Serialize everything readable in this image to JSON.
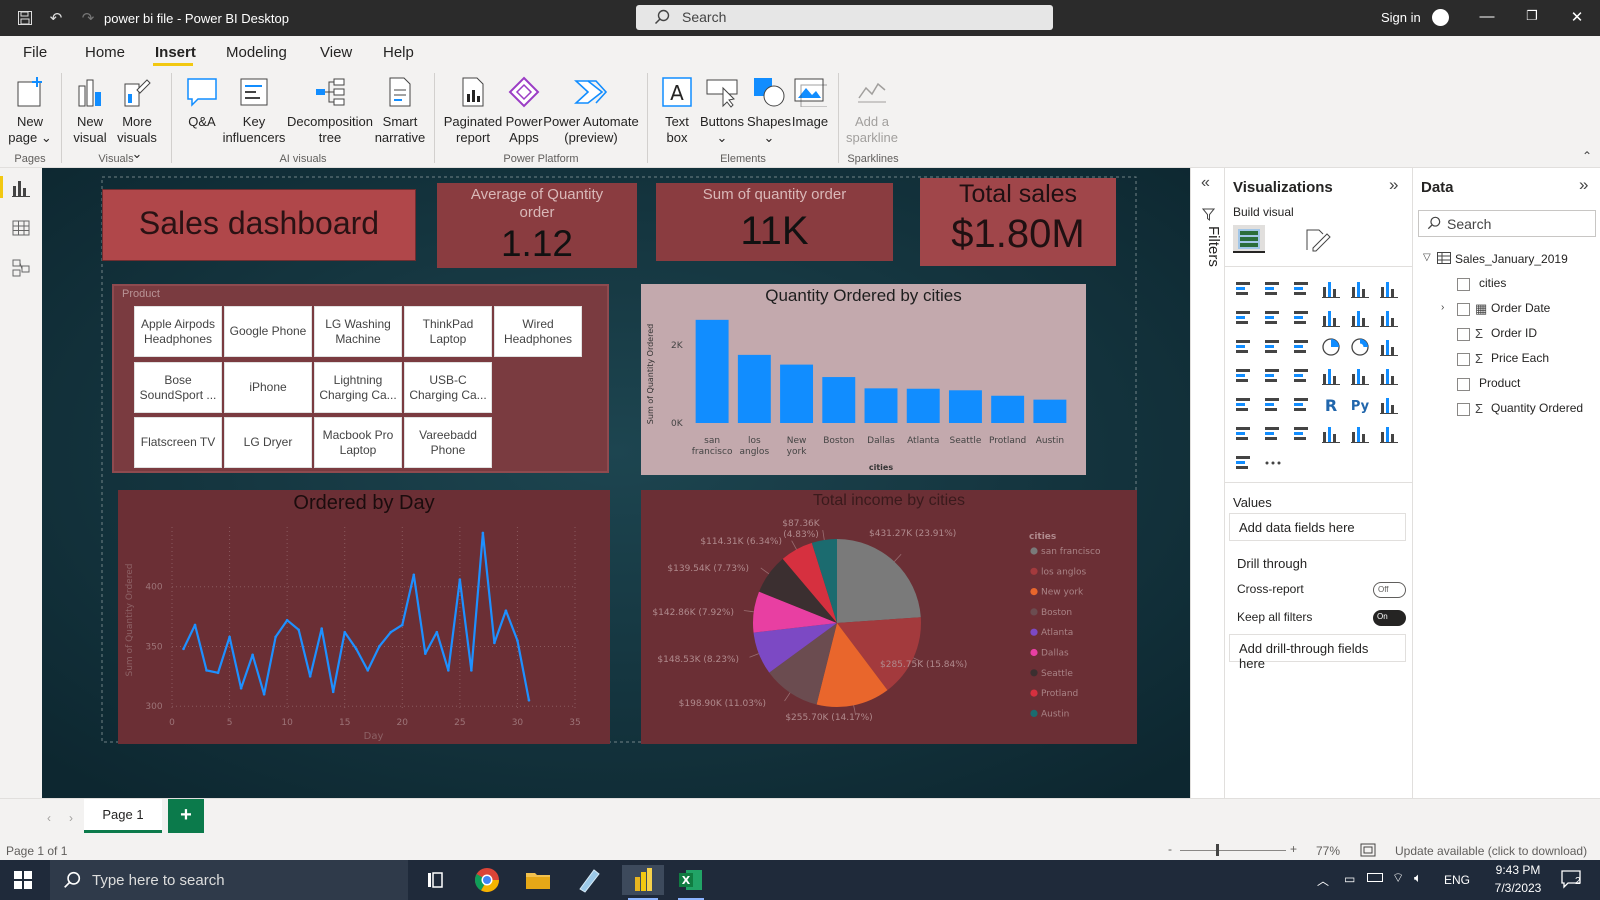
{
  "titlebar": {
    "title": "power bi file - Power BI Desktop",
    "search_placeholder": "Search",
    "signin": "Sign in"
  },
  "menu": [
    "File",
    "Home",
    "Insert",
    "Modeling",
    "View",
    "Help"
  ],
  "ribbon": {
    "buttons": [
      {
        "label1": "New",
        "label2": "page ⌄"
      },
      {
        "label1": "New",
        "label2": "visual"
      },
      {
        "label1": "More",
        "label2": "visuals ⌄"
      },
      {
        "label1": "Q&A",
        "label2": ""
      },
      {
        "label1": "Key",
        "label2": "influencers"
      },
      {
        "label1": "Decomposition",
        "label2": "tree"
      },
      {
        "label1": "Smart",
        "label2": "narrative"
      },
      {
        "label1": "Paginated",
        "label2": "report"
      },
      {
        "label1": "Power",
        "label2": "Apps"
      },
      {
        "label1": "Power Automate",
        "label2": "(preview)"
      },
      {
        "label1": "Text",
        "label2": "box"
      },
      {
        "label1": "Buttons",
        "label2": "⌄"
      },
      {
        "label1": "Shapes",
        "label2": "⌄"
      },
      {
        "label1": "Image",
        "label2": ""
      },
      {
        "label1": "Add a",
        "label2": "sparkline"
      }
    ],
    "groups": [
      "Pages",
      "Visuals",
      "AI visuals",
      "Power Platform",
      "Elements",
      "Sparklines"
    ]
  },
  "dashboard": {
    "title": "Sales dashboard",
    "cards": [
      {
        "label": "Average of Quantity order",
        "value": "1.12"
      },
      {
        "label": "Sum of quantity order",
        "value": "11K"
      },
      {
        "label": "Total sales",
        "value": "$1.80M"
      }
    ],
    "slicer": {
      "title": "Product",
      "items": [
        "Apple Airpods Headphones",
        "Google Phone",
        "LG Washing Machine",
        "ThinkPad Laptop",
        "Wired Headphones",
        "Bose SoundSport ...",
        "iPhone",
        "Lightning Charging Ca...",
        "USB-C Charging Ca...",
        "Flatscreen TV",
        "LG Dryer",
        "Macbook Pro Laptop",
        "Vareebadd Phone"
      ]
    }
  },
  "chart_data": [
    {
      "type": "bar",
      "title": "Quantity Ordered by cities",
      "xlabel": "cities",
      "ylabel": "Sum of Quantity Ordered",
      "categories": [
        "san francisco",
        "los anglos",
        "New york",
        "Boston",
        "Dallas",
        "Atlanta",
        "Seattle",
        "Protland",
        "Austin"
      ],
      "values": [
        2650,
        1750,
        1500,
        1180,
        890,
        880,
        840,
        700,
        600
      ],
      "ylim": [
        0,
        2800
      ],
      "yticks": [
        0,
        2000
      ],
      "ytick_labels": [
        "0K",
        "2K"
      ],
      "color": "#118dff"
    },
    {
      "type": "line",
      "title": "Ordered by Day",
      "xlabel": "Day",
      "ylabel": "Sum of Quantity Ordered",
      "x": [
        1,
        2,
        3,
        4,
        5,
        6,
        7,
        8,
        9,
        10,
        11,
        12,
        13,
        14,
        15,
        16,
        17,
        18,
        19,
        20,
        21,
        22,
        23,
        24,
        25,
        26,
        27,
        28,
        29,
        30,
        31
      ],
      "y": [
        348,
        368,
        330,
        328,
        358,
        315,
        343,
        310,
        358,
        372,
        364,
        325,
        365,
        312,
        362,
        348,
        330,
        350,
        362,
        368,
        410,
        344,
        362,
        330,
        406,
        330,
        445,
        353,
        380,
        355,
        305
      ],
      "xlim": [
        0,
        35
      ],
      "ylim": [
        296,
        450
      ],
      "xticks": [
        0,
        5,
        10,
        15,
        20,
        25,
        30,
        35
      ],
      "yticks": [
        300,
        350,
        400
      ],
      "color": "#1e90ff"
    },
    {
      "type": "pie",
      "title": "Total income by cities",
      "legend_title": "cities",
      "legend_position": "right",
      "slices": [
        {
          "name": "san francisco",
          "value": 431.27,
          "label": "$431.27K (23.91%)",
          "color": "#7a7a7a"
        },
        {
          "name": "los anglos",
          "value": 285.75,
          "label": "$285.75K (15.84%)",
          "color": "#a33a3d"
        },
        {
          "name": "New york",
          "value": 255.7,
          "label": "$255.70K (14.17%)",
          "color": "#e9662c"
        },
        {
          "name": "Boston",
          "value": 198.9,
          "label": "$198.90K (11.03%)",
          "color": "#6b4c50"
        },
        {
          "name": "Atlanta",
          "value": 148.53,
          "label": "$148.53K (8.23%)",
          "color": "#7c49c4"
        },
        {
          "name": "Dallas",
          "value": 142.86,
          "label": "$142.86K (7.92%)",
          "color": "#e83fa2"
        },
        {
          "name": "Seattle",
          "value": 139.54,
          "label": "$139.54K (7.73%)",
          "color": "#3b2f30"
        },
        {
          "name": "Protland",
          "value": 114.31,
          "label": "$114.31K (6.34%)",
          "color": "#d6303f"
        },
        {
          "name": "Austin",
          "value": 87.36,
          "label": "$87.36K (4.83%)",
          "color": "#1b6b6f"
        }
      ]
    }
  ],
  "visualizations": {
    "title": "Visualizations",
    "build": "Build visual",
    "values_label": "Values",
    "values_placeholder": "Add data fields here",
    "drill": "Drill through",
    "cross": "Cross-report",
    "cross_state": "Off",
    "keep": "Keep all filters",
    "keep_state": "On",
    "drill_placeholder": "Add drill-through fields here"
  },
  "filters_label": "Filters",
  "data": {
    "title": "Data",
    "search_placeholder": "Search",
    "table": "Sales_January_2019",
    "fields": [
      "cities",
      "Order Date",
      "Order ID",
      "Price Each",
      "Product",
      "Quantity Ordered"
    ]
  },
  "pages": {
    "page1": "Page 1",
    "add": "+"
  },
  "status": {
    "page": "Page 1 of 1",
    "zoom": "77%",
    "update": "Update available (click to download)"
  },
  "taskbar": {
    "search": "Type here to search",
    "time": "9:43 PM",
    "date": "7/3/2023",
    "lang": "ENG",
    "notif": "2"
  }
}
